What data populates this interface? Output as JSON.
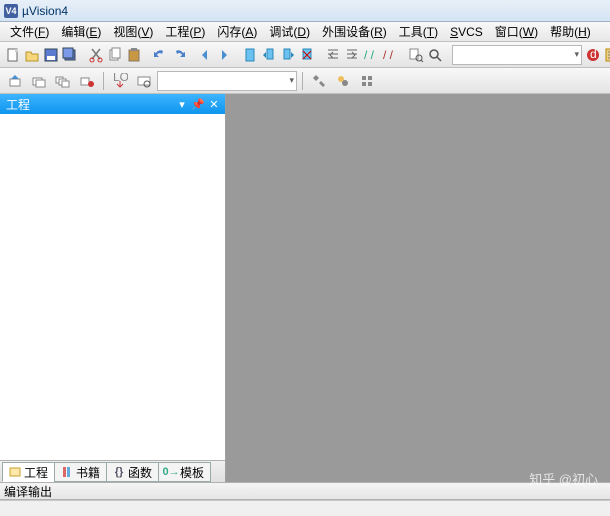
{
  "app": {
    "title": "µVision4",
    "icon_text": "V4"
  },
  "menu": {
    "items": [
      {
        "label": "文件",
        "accel": "F"
      },
      {
        "label": "编辑",
        "accel": "E"
      },
      {
        "label": "视图",
        "accel": "V"
      },
      {
        "label": "工程",
        "accel": "P"
      },
      {
        "label": "闪存",
        "accel": "A"
      },
      {
        "label": "调试",
        "accel": "D"
      },
      {
        "label": "外围设备",
        "accel": "R"
      },
      {
        "label": "工具",
        "accel": "T"
      },
      {
        "label": "SVCS",
        "accel": ""
      },
      {
        "label": "窗口",
        "accel": "W"
      },
      {
        "label": "帮助",
        "accel": "H"
      }
    ]
  },
  "toolbar1": {
    "icons": [
      "new-file-icon",
      "open-file-icon",
      "save-icon",
      "save-all-icon",
      "sep",
      "cut-icon",
      "copy-icon",
      "paste-icon",
      "sep",
      "undo-icon",
      "redo-icon",
      "sep",
      "nav-back-icon",
      "nav-fwd-icon",
      "sep",
      "bookmark-icon",
      "bookmark-prev-icon",
      "bookmark-next-icon",
      "bookmark-clear-icon",
      "sep",
      "indent-left-icon",
      "indent-right-icon",
      "comment-icon",
      "uncomment-icon",
      "sep",
      "find-in-files-icon",
      "find-icon",
      "sep"
    ],
    "right_icons": [
      "debug-start-icon",
      "config-icon"
    ]
  },
  "toolbar2": {
    "icons": [
      "build-icon",
      "rebuild-icon",
      "build-all-icon",
      "stop-build-icon",
      "sep",
      "download-icon",
      "target-options-icon"
    ],
    "target_combo": "",
    "right_icons": [
      "toolbox-icon",
      "wizard-icon",
      "manage-icon"
    ]
  },
  "project_panel": {
    "title": "工程",
    "tabs": [
      {
        "label": "工程",
        "icon": "project-tab-icon",
        "active": true
      },
      {
        "label": "书籍",
        "icon": "books-tab-icon",
        "active": false
      },
      {
        "label": "函数",
        "icon": "func-tab-icon",
        "active": false
      },
      {
        "label": "模板",
        "icon": "template-tab-icon",
        "active": false
      }
    ]
  },
  "output_panel": {
    "title": "编译输出"
  },
  "watermark": "知乎 @初心"
}
